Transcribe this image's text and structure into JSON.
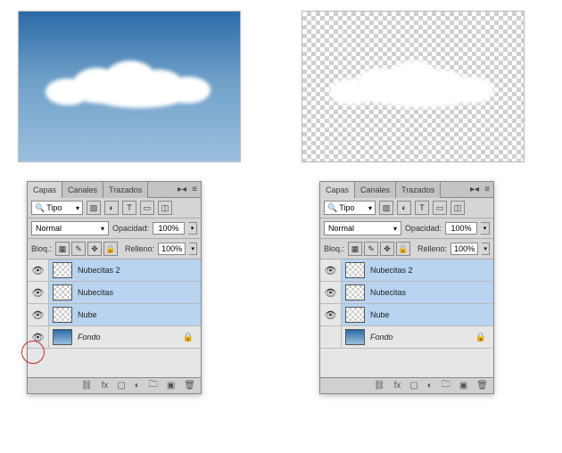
{
  "tabs": {
    "layers": "Capas",
    "channels": "Canales",
    "paths": "Trazados"
  },
  "filter": {
    "label": "Tipo"
  },
  "blend": {
    "mode": "Normal",
    "opacity_label": "Opacidad:",
    "opacity_value": "100%"
  },
  "lock": {
    "label": "Bloq.:",
    "fill_label": "Relleno:",
    "fill_value": "100%"
  },
  "layers_left": [
    {
      "name": "Nubecitas 2",
      "selected": true,
      "italic": false,
      "thumb": "trans",
      "eye": true,
      "locked": false
    },
    {
      "name": "Nubecitas",
      "selected": true,
      "italic": false,
      "thumb": "trans",
      "eye": true,
      "locked": false
    },
    {
      "name": "Nube",
      "selected": true,
      "italic": false,
      "thumb": "trans",
      "eye": true,
      "locked": false
    },
    {
      "name": "Fondo",
      "selected": false,
      "italic": true,
      "thumb": "grad",
      "eye": true,
      "locked": true
    }
  ],
  "layers_right": [
    {
      "name": "Nubecitas 2",
      "selected": true,
      "italic": false,
      "thumb": "trans",
      "eye": true,
      "locked": false
    },
    {
      "name": "Nubecitas",
      "selected": true,
      "italic": false,
      "thumb": "trans",
      "eye": true,
      "locked": false
    },
    {
      "name": "Nube",
      "selected": true,
      "italic": false,
      "thumb": "trans",
      "eye": true,
      "locked": false
    },
    {
      "name": "Fondo",
      "selected": false,
      "italic": true,
      "thumb": "grad",
      "eye": false,
      "locked": true
    }
  ]
}
